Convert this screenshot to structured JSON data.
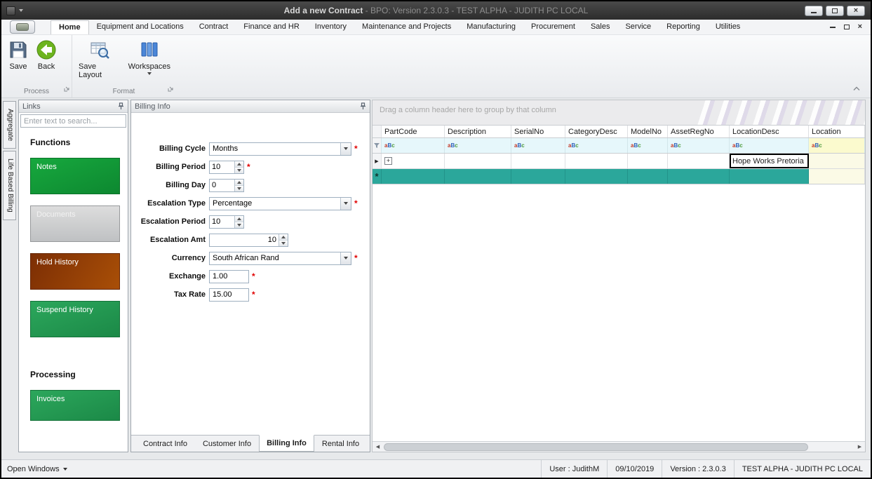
{
  "window": {
    "title_main": "Add a new Contract",
    "title_rest": " - BPO: Version 2.3.0.3 - TEST ALPHA - JUDITH PC LOCAL"
  },
  "ribbon": {
    "tabs": [
      "Home",
      "Equipment and Locations",
      "Contract",
      "Finance and HR",
      "Inventory",
      "Maintenance and Projects",
      "Manufacturing",
      "Procurement",
      "Sales",
      "Service",
      "Reporting",
      "Utilities"
    ],
    "active_tab": "Home",
    "actions": {
      "save": "Save",
      "back": "Back",
      "save_layout": "Save Layout",
      "workspaces": "Workspaces"
    },
    "groups": {
      "process": "Process",
      "format": "Format"
    }
  },
  "side_tabs": [
    "Aggregate",
    "Life Based Billing"
  ],
  "links": {
    "title": "Links",
    "search_placeholder": "Enter text to search...",
    "headings": {
      "functions": "Functions",
      "processing": "Processing"
    },
    "buttons": {
      "notes": "Notes",
      "documents": "Documents",
      "hold_history": "Hold History",
      "suspend_history": "Suspend History",
      "invoices": "Invoices"
    }
  },
  "billing": {
    "title": "Billing Info",
    "fields": [
      {
        "label": "Billing Cycle",
        "value": "Months",
        "required": true
      },
      {
        "label": "Billing Period",
        "value": "10",
        "required": true
      },
      {
        "label": "Billing Day",
        "value": "0",
        "required": false
      },
      {
        "label": "Escalation Type",
        "value": "Percentage",
        "required": true
      },
      {
        "label": "Escalation Period",
        "value": "10",
        "required": false
      },
      {
        "label": "Escalation Amt",
        "value": "10",
        "required": false
      },
      {
        "label": "Currency",
        "value": "South African Rand",
        "required": true
      },
      {
        "label": "Exchange",
        "value": "1.00",
        "required": true
      },
      {
        "label": "Tax Rate",
        "value": "15.00",
        "required": true
      }
    ],
    "tabs": [
      "Contract Info",
      "Customer Info",
      "Billing Info",
      "Rental Info"
    ],
    "active_tab": "Billing Info"
  },
  "grid": {
    "group_hint": "Drag a column header here to group by that column",
    "columns": [
      "PartCode",
      "Description",
      "SerialNo",
      "CategoryDesc",
      "ModelNo",
      "AssetRegNo",
      "LocationDesc",
      "Location"
    ],
    "filter_icon": {
      "a": "a",
      "b": "B",
      "c": "c"
    },
    "data_row": {
      "location_desc": "Hope Works Pretoria"
    },
    "new_row_indicator": "*"
  },
  "status": {
    "open_windows": "Open Windows",
    "user": "User : JudithM",
    "date": "09/10/2019",
    "version": "Version : 2.3.0.3",
    "environment": "TEST ALPHA - JUDITH PC LOCAL"
  },
  "colors": {
    "new_row_teal": "#2BA79B",
    "button_green": "#119A3C",
    "button_rust": "#9C4A06",
    "button_silver": "#CFCFCF",
    "required_red": "#E00000",
    "filter_row_cyan": "#E6F7FB",
    "readonly_yellow": "#FBFAE6"
  }
}
